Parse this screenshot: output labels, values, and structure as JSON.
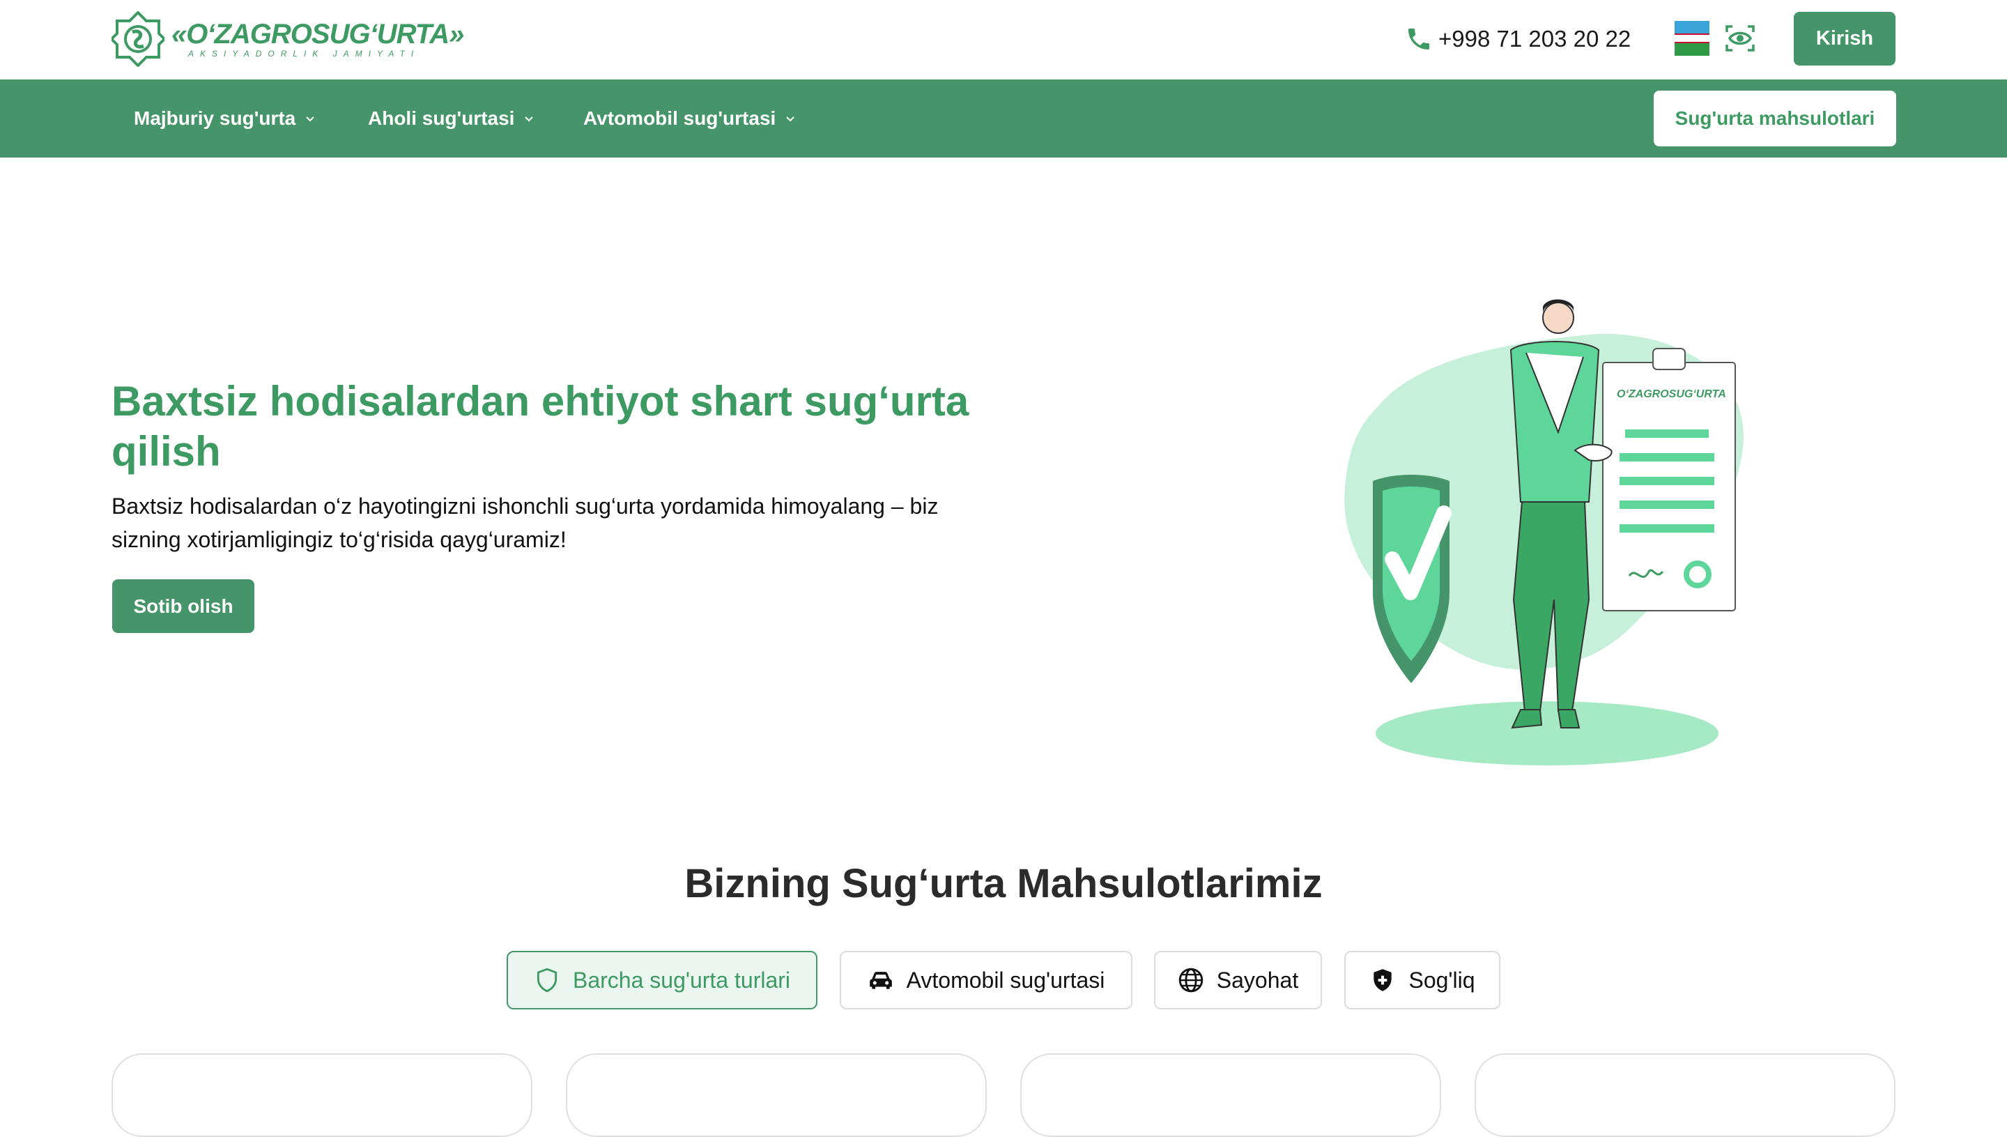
{
  "header": {
    "logo": {
      "name": "«O‘ZAGROSUG‘URTA»",
      "subtitle": "AKSIYADORLIK JAMIYATI"
    },
    "phone": "+998 71 203 20 22",
    "language_flag": "uzbekistan-flag",
    "accessibility_icon": "eye-icon",
    "login_label": "Kirish"
  },
  "nav": {
    "items": [
      {
        "label": "Majburiy sug'urta"
      },
      {
        "label": "Aholi sug'urtasi"
      },
      {
        "label": "Avtomobil sug'urtasi"
      }
    ],
    "products_label": "Sug'urta mahsulotlari"
  },
  "hero": {
    "title": "Baxtsiz hodisalardan ehtiyot shart sug‘urta qilish",
    "description": "Baxtsiz hodisalardan o‘z hayotingizni ishonchli sug‘urta yordamida himoyalang – biz sizning xotirjamligingiz to‘g‘risida qayg‘uramiz!",
    "button_label": "Sotib olish",
    "illustration_document_text": "O‘ZAGROSUG‘URTA"
  },
  "products": {
    "title": "Bizning Sug‘urta Mahsulotlarimiz",
    "tabs": [
      {
        "label": "Barcha sug'urta turlari",
        "icon": "shield-icon",
        "active": true
      },
      {
        "label": "Avtomobil sug'urtasi",
        "icon": "car-icon",
        "active": false
      },
      {
        "label": "Sayohat",
        "icon": "globe-icon",
        "active": false
      },
      {
        "label": "Sog'liq",
        "icon": "health-shield-icon",
        "active": false
      }
    ]
  },
  "colors": {
    "brand": "#46956a",
    "brand_text": "#3e9a63",
    "active_tab_bg": "#eaf6ef"
  }
}
